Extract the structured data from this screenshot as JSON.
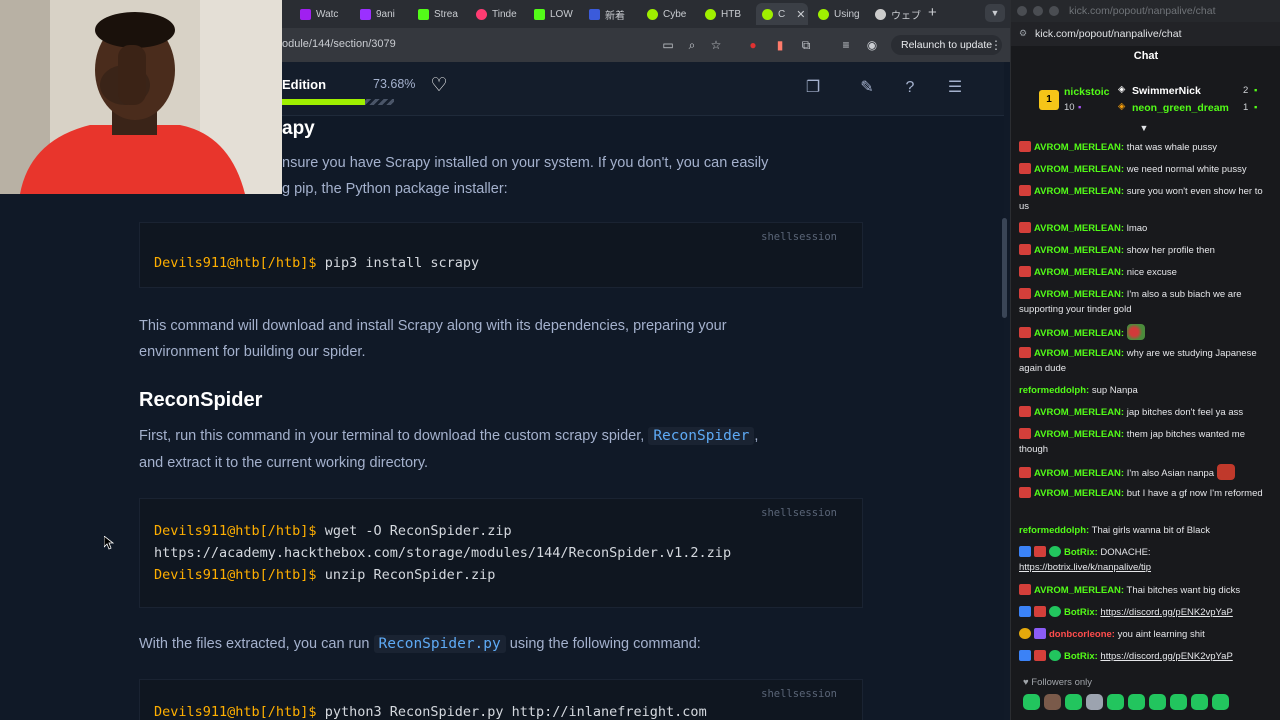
{
  "browser": {
    "tabs": [
      {
        "label": "Watc",
        "color": "#a020f0"
      },
      {
        "label": "9ani",
        "color": "#9b30ff"
      },
      {
        "label": "Strea",
        "color": "#53fc18"
      },
      {
        "label": "Tinde",
        "color": "#fe3c72"
      },
      {
        "label": "LOW",
        "color": "#53fc18"
      },
      {
        "label": "新着",
        "color": "#3b5bdb"
      },
      {
        "label": "Cybe",
        "color": "#9fef00"
      },
      {
        "label": "HTB",
        "color": "#9fef00"
      },
      {
        "label": "C",
        "color": "#9fef00"
      },
      {
        "label": "Using",
        "color": "#9fef00"
      },
      {
        "label": "ウェブ",
        "color": "#cccccc"
      }
    ],
    "url": "odule/144/section/3079",
    "relaunch_label": "Relaunch to update"
  },
  "module_header": {
    "edition": "Edition",
    "percent": "73.68%",
    "progress": 0.7368
  },
  "content": {
    "heading_partial": "apy",
    "intro_line1": "nsure you have Scrapy installed on your system. If you don't, you can easily",
    "intro_line2": "g pip, the Python package installer:",
    "code1": {
      "lang": "shellsession",
      "prompt": "Devils911@htb[/htb]$",
      "cmd": " pip3 install scrapy"
    },
    "para2_line1": "This command will download and install Scrapy along with its dependencies, preparing your",
    "para2_line2": "environment for building our spider.",
    "section_title": "ReconSpider",
    "para3_pre": "First, run this command in your terminal to download the custom scrapy spider, ",
    "para3_code": "ReconSpider",
    "para3_post": ",",
    "para3_line2": "and extract it to the current working directory.",
    "code2": {
      "lang": "shellsession",
      "l1_prompt": "Devils911@htb[/htb]$",
      "l1_cmd": " wget -O ReconSpider.zip",
      "l2": "https://academy.hackthebox.com/storage/modules/144/ReconSpider.v1.2.zip",
      "l3_prompt": "Devils911@htb[/htb]$",
      "l3_cmd": " unzip ReconSpider.zip"
    },
    "para4_pre": "With the files extracted, you can run ",
    "para4_code": "ReconSpider.py",
    "para4_post": " using the following command:",
    "code3": {
      "lang": "shellsession",
      "prompt": "Devils911@htb[/htb]$",
      "cmd": " python3 ReconSpider.py http://inlanefreight.com"
    }
  },
  "chat": {
    "window_title": "kick.com/popout/nanpalive/chat",
    "url": "kick.com/popout/nanpalive/chat",
    "header": "Chat",
    "leaderboard": {
      "rank": "1",
      "first_name": "nickstoic",
      "first_count": "10",
      "second_name": "SwimmerNick",
      "second_count": "2",
      "third_name": "neon_green_dream",
      "third_count": "1"
    },
    "messages": [
      {
        "user": "AVROM_MERLEAN:",
        "text": " that was whale pussy"
      },
      {
        "user": "AVROM_MERLEAN:",
        "text": " we need normal white pussy"
      },
      {
        "user": "AVROM_MERLEAN:",
        "text": " sure you won't even show her to us"
      },
      {
        "user": "AVROM_MERLEAN:",
        "text": " lmao"
      },
      {
        "user": "AVROM_MERLEAN:",
        "text": " show her profile then"
      },
      {
        "user": "AVROM_MERLEAN:",
        "text": " nice excuse"
      },
      {
        "user": "AVROM_MERLEAN:",
        "text": " I'm also a sub biach we are supporting your tinder gold"
      },
      {
        "user": "AVROM_MERLEAN:",
        "text": ""
      },
      {
        "user": "AVROM_MERLEAN:",
        "text": " why are we studying Japanese again dude"
      },
      {
        "user": "reformeddolph:",
        "text": " sup Nanpa"
      },
      {
        "user": "AVROM_MERLEAN:",
        "text": " jap bitches don't feel ya ass"
      },
      {
        "user": "AVROM_MERLEAN:",
        "text": " them jap bitches wanted me though"
      },
      {
        "user": "AVROM_MERLEAN:",
        "text": " I'm also Asian nanpa"
      },
      {
        "user": "AVROM_MERLEAN:",
        "text": " but I have a gf now I'm reformed"
      },
      {
        "user": "reformeddolph:",
        "text": " Thai girls wanna bit of Black"
      },
      {
        "user": "BotRix:",
        "text": " DONACHE:",
        "link": "https://botrix.live/k/nanpalive/tip"
      },
      {
        "user": "AVROM_MERLEAN:",
        "text": " Thai bitches want big dicks"
      },
      {
        "user": "BotRix:",
        "text": " ",
        "link": "https://discord.gg/pENK2vpYaP"
      },
      {
        "user": "donbcorleone:",
        "text": " you aint learning shit"
      },
      {
        "user": "BotRix:",
        "text": " ",
        "link": "https://discord.gg/pENK2vpYaP"
      }
    ],
    "followers_only": "Followers only"
  }
}
